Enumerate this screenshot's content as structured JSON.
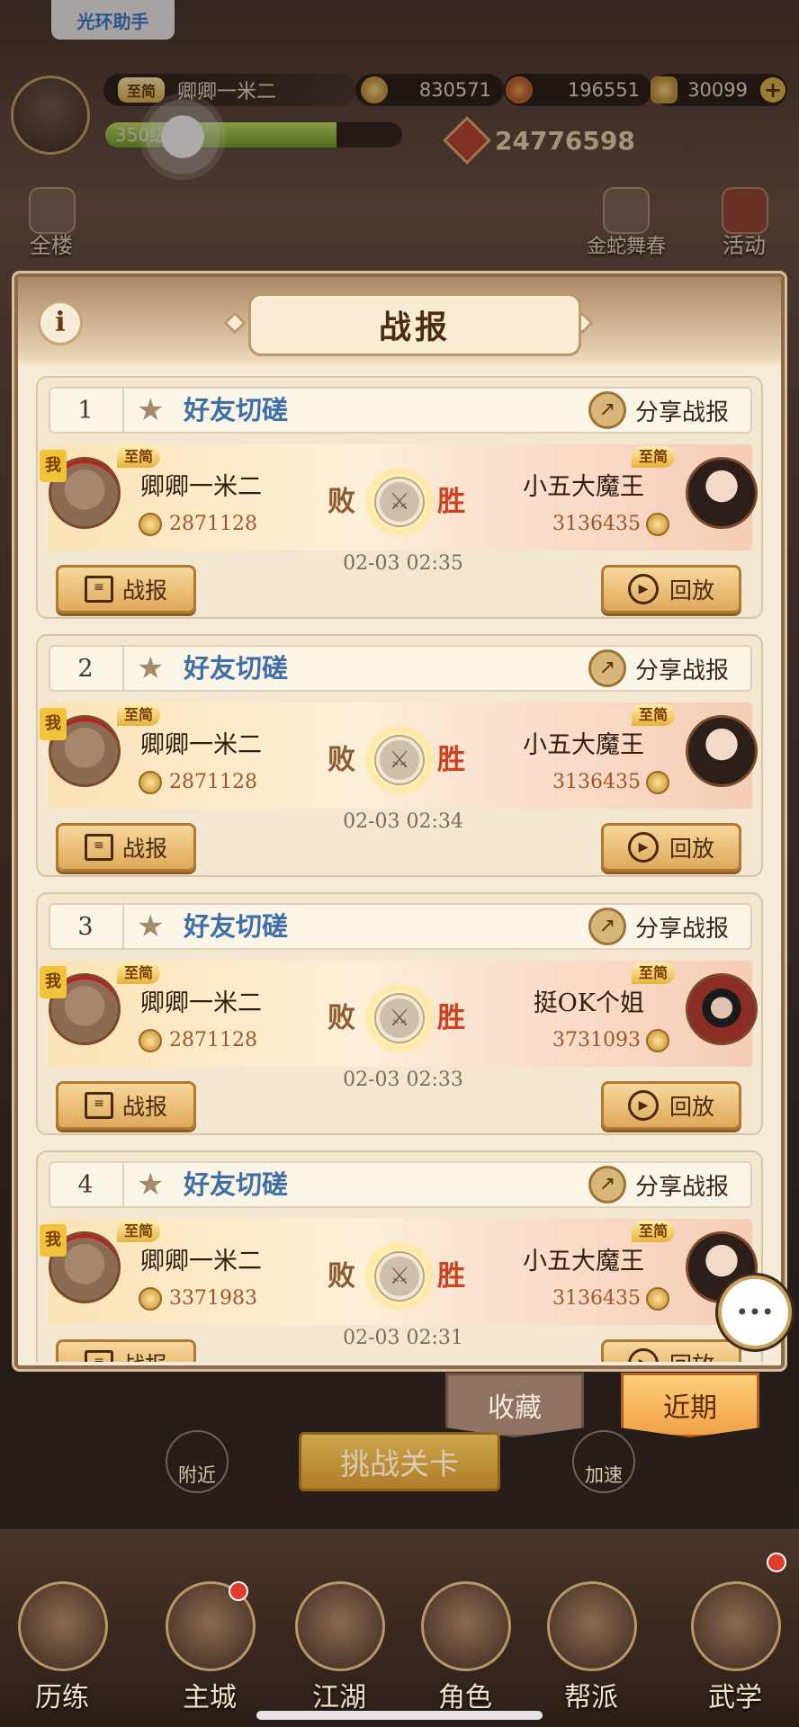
{
  "top_helper": "光环助手",
  "player": {
    "vip": "至简",
    "name": "卿卿一米二",
    "level": "350级",
    "level_progress": 0.78
  },
  "resources": [
    {
      "icon": "copper-coin-icon",
      "value": "830571"
    },
    {
      "icon": "spirit-icon",
      "value": "196551"
    },
    {
      "icon": "gold-ingot-icon",
      "value": "30099"
    }
  ],
  "power": "24776598",
  "side_icons": {
    "left": "全楼",
    "right": "活动",
    "event": "金蛇舞春"
  },
  "dialog": {
    "title": "战报",
    "records": [
      {
        "index": "1",
        "mode": "好友切磋",
        "share": "分享战报",
        "me": {
          "tier": "至简",
          "name": "卿卿一米二",
          "score": "2871128",
          "tag": "我"
        },
        "opp": {
          "tier": "至简",
          "name": "小五大魔王",
          "score": "3136435"
        },
        "result_left": "败",
        "result_right": "胜",
        "time": "02-03 02:35",
        "report_btn": "战报",
        "replay_btn": "回放"
      },
      {
        "index": "2",
        "mode": "好友切磋",
        "share": "分享战报",
        "me": {
          "tier": "至简",
          "name": "卿卿一米二",
          "score": "2871128",
          "tag": "我"
        },
        "opp": {
          "tier": "至简",
          "name": "小五大魔王",
          "score": "3136435"
        },
        "result_left": "败",
        "result_right": "胜",
        "time": "02-03 02:34",
        "report_btn": "战报",
        "replay_btn": "回放"
      },
      {
        "index": "3",
        "mode": "好友切磋",
        "share": "分享战报",
        "me": {
          "tier": "至简",
          "name": "卿卿一米二",
          "score": "2871128",
          "tag": "我"
        },
        "opp": {
          "tier": "至简",
          "name": "挺OK个姐",
          "score": "3731093"
        },
        "result_left": "败",
        "result_right": "胜",
        "time": "02-03 02:33",
        "report_btn": "战报",
        "replay_btn": "回放"
      },
      {
        "index": "4",
        "mode": "好友切磋",
        "share": "分享战报",
        "me": {
          "tier": "至简",
          "name": "卿卿一米二",
          "score": "3371983",
          "tag": "我"
        },
        "opp": {
          "tier": "至简",
          "name": "小五大魔王",
          "score": "3136435"
        },
        "result_left": "败",
        "result_right": "胜",
        "time": "02-03 02:31",
        "report_btn": "战报",
        "replay_btn": "回放"
      }
    ]
  },
  "tabs": {
    "favorites": "收藏",
    "recent": "近期"
  },
  "challenge_btn": "挑战关卡",
  "mini": {
    "nearby": "附近",
    "speed": "加速"
  },
  "nav": [
    "历练",
    "主城",
    "江湖",
    "角色",
    "帮派",
    "武学"
  ]
}
